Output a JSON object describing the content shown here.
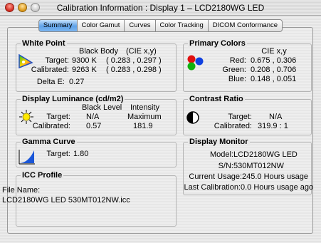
{
  "window": {
    "title": "Calibration Information : Display 1 –  LCD2180WG LED"
  },
  "tabs": [
    {
      "label": "Summary",
      "active": true
    },
    {
      "label": "Color Gamut",
      "active": false
    },
    {
      "label": "Curves",
      "active": false
    },
    {
      "label": "Color Tracking",
      "active": false
    },
    {
      "label": "DICOM Conformance",
      "active": false
    }
  ],
  "white_point": {
    "title": "White Point",
    "col1_header": "Black Body",
    "col2_header": "(CIE x,y)",
    "target_label": "Target:",
    "target_temp": "9300 K",
    "target_xy": "( 0.283 , 0.297 )",
    "calibrated_label": "Calibrated:",
    "calibrated_temp": "9263 K",
    "calibrated_xy": "( 0.283 , 0.298 )",
    "delta_label": "Delta E:",
    "delta_value": "0.27"
  },
  "primary_colors": {
    "title": "Primary Colors",
    "header": "CIE x,y",
    "red_label": "Red:",
    "red_value": "0.675 , 0.306",
    "green_label": "Green:",
    "green_value": "0.208 , 0.706",
    "blue_label": "Blue:",
    "blue_value": "0.148 , 0.051"
  },
  "luminance": {
    "title": "Display Luminance (cd/m2)",
    "col1_header": "Black Level",
    "col2_header": "Intensity",
    "target_label": "Target:",
    "target_black": "N/A",
    "target_intensity": "Maximum",
    "calibrated_label": "Calibrated:",
    "calibrated_black": "0.57",
    "calibrated_intensity": "181.9"
  },
  "contrast": {
    "title": "Contrast Ratio",
    "target_label": "Target:",
    "target_value": "N/A",
    "calibrated_label": "Calibrated:",
    "calibrated_value": "319.9 : 1"
  },
  "gamma": {
    "title": "Gamma Curve",
    "target_label": "Target:",
    "target_value": "1.80"
  },
  "monitor": {
    "title": "Display Monitor",
    "model_label": "Model:",
    "model_value": "LCD2180WG LED",
    "sn_label": "S/N:",
    "sn_value": "530MT012NW",
    "usage_label": "Current Usage:",
    "usage_value": "245.0 Hours usage",
    "last_cal_label": "Last Calibration:",
    "last_cal_value": "0.0 Hours usage ago"
  },
  "icc": {
    "title": "ICC Profile",
    "file_label": "File Name:",
    "file_value": "LCD2180WG LED 530MT012NW.icc"
  },
  "colors": {
    "accent_tab": "#5ea1e8",
    "sun": "#ffe800",
    "red": "#e01010",
    "green": "#10b010",
    "blue": "#1040e0"
  }
}
